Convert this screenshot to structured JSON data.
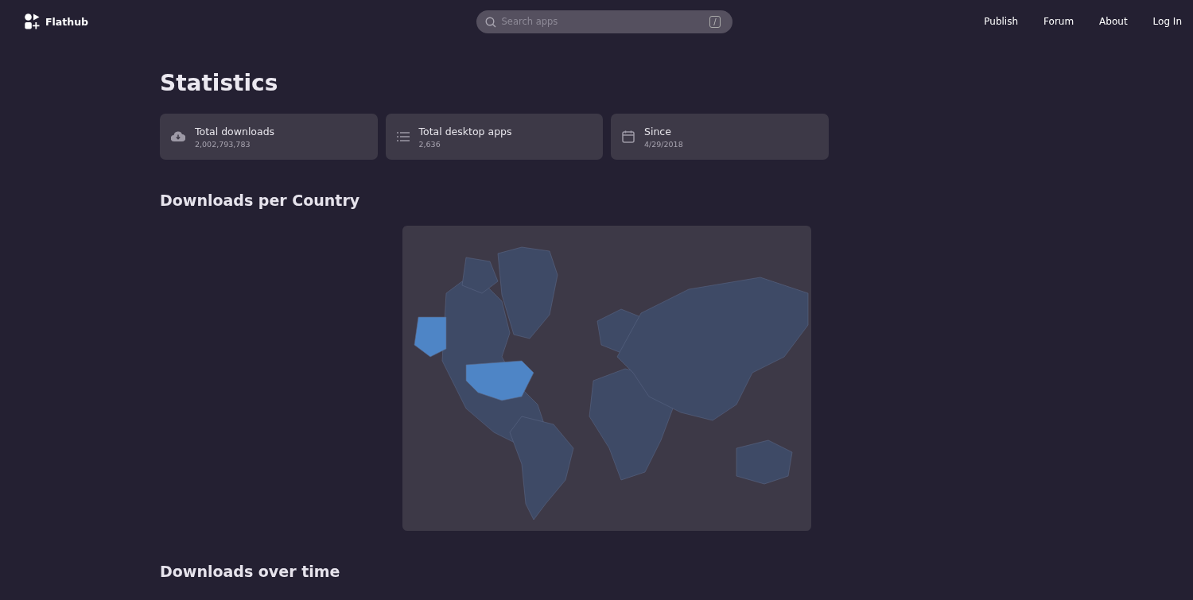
{
  "header": {
    "brand": "Flathub",
    "search": {
      "placeholder": "Search apps",
      "shortcut": "/"
    },
    "nav": [
      "Publish",
      "Forum",
      "About",
      "Log In"
    ]
  },
  "title": "Statistics",
  "stats": [
    {
      "kind": "downloads",
      "label": "Total downloads",
      "value": "2,002,793,783"
    },
    {
      "kind": "apps",
      "label": "Total desktop apps",
      "value": "2,636"
    },
    {
      "kind": "since",
      "label": "Since",
      "value": "4/29/2018"
    }
  ],
  "sections": [
    {
      "heading": "Downloads per Country"
    },
    {
      "heading": "Downloads over time"
    }
  ]
}
